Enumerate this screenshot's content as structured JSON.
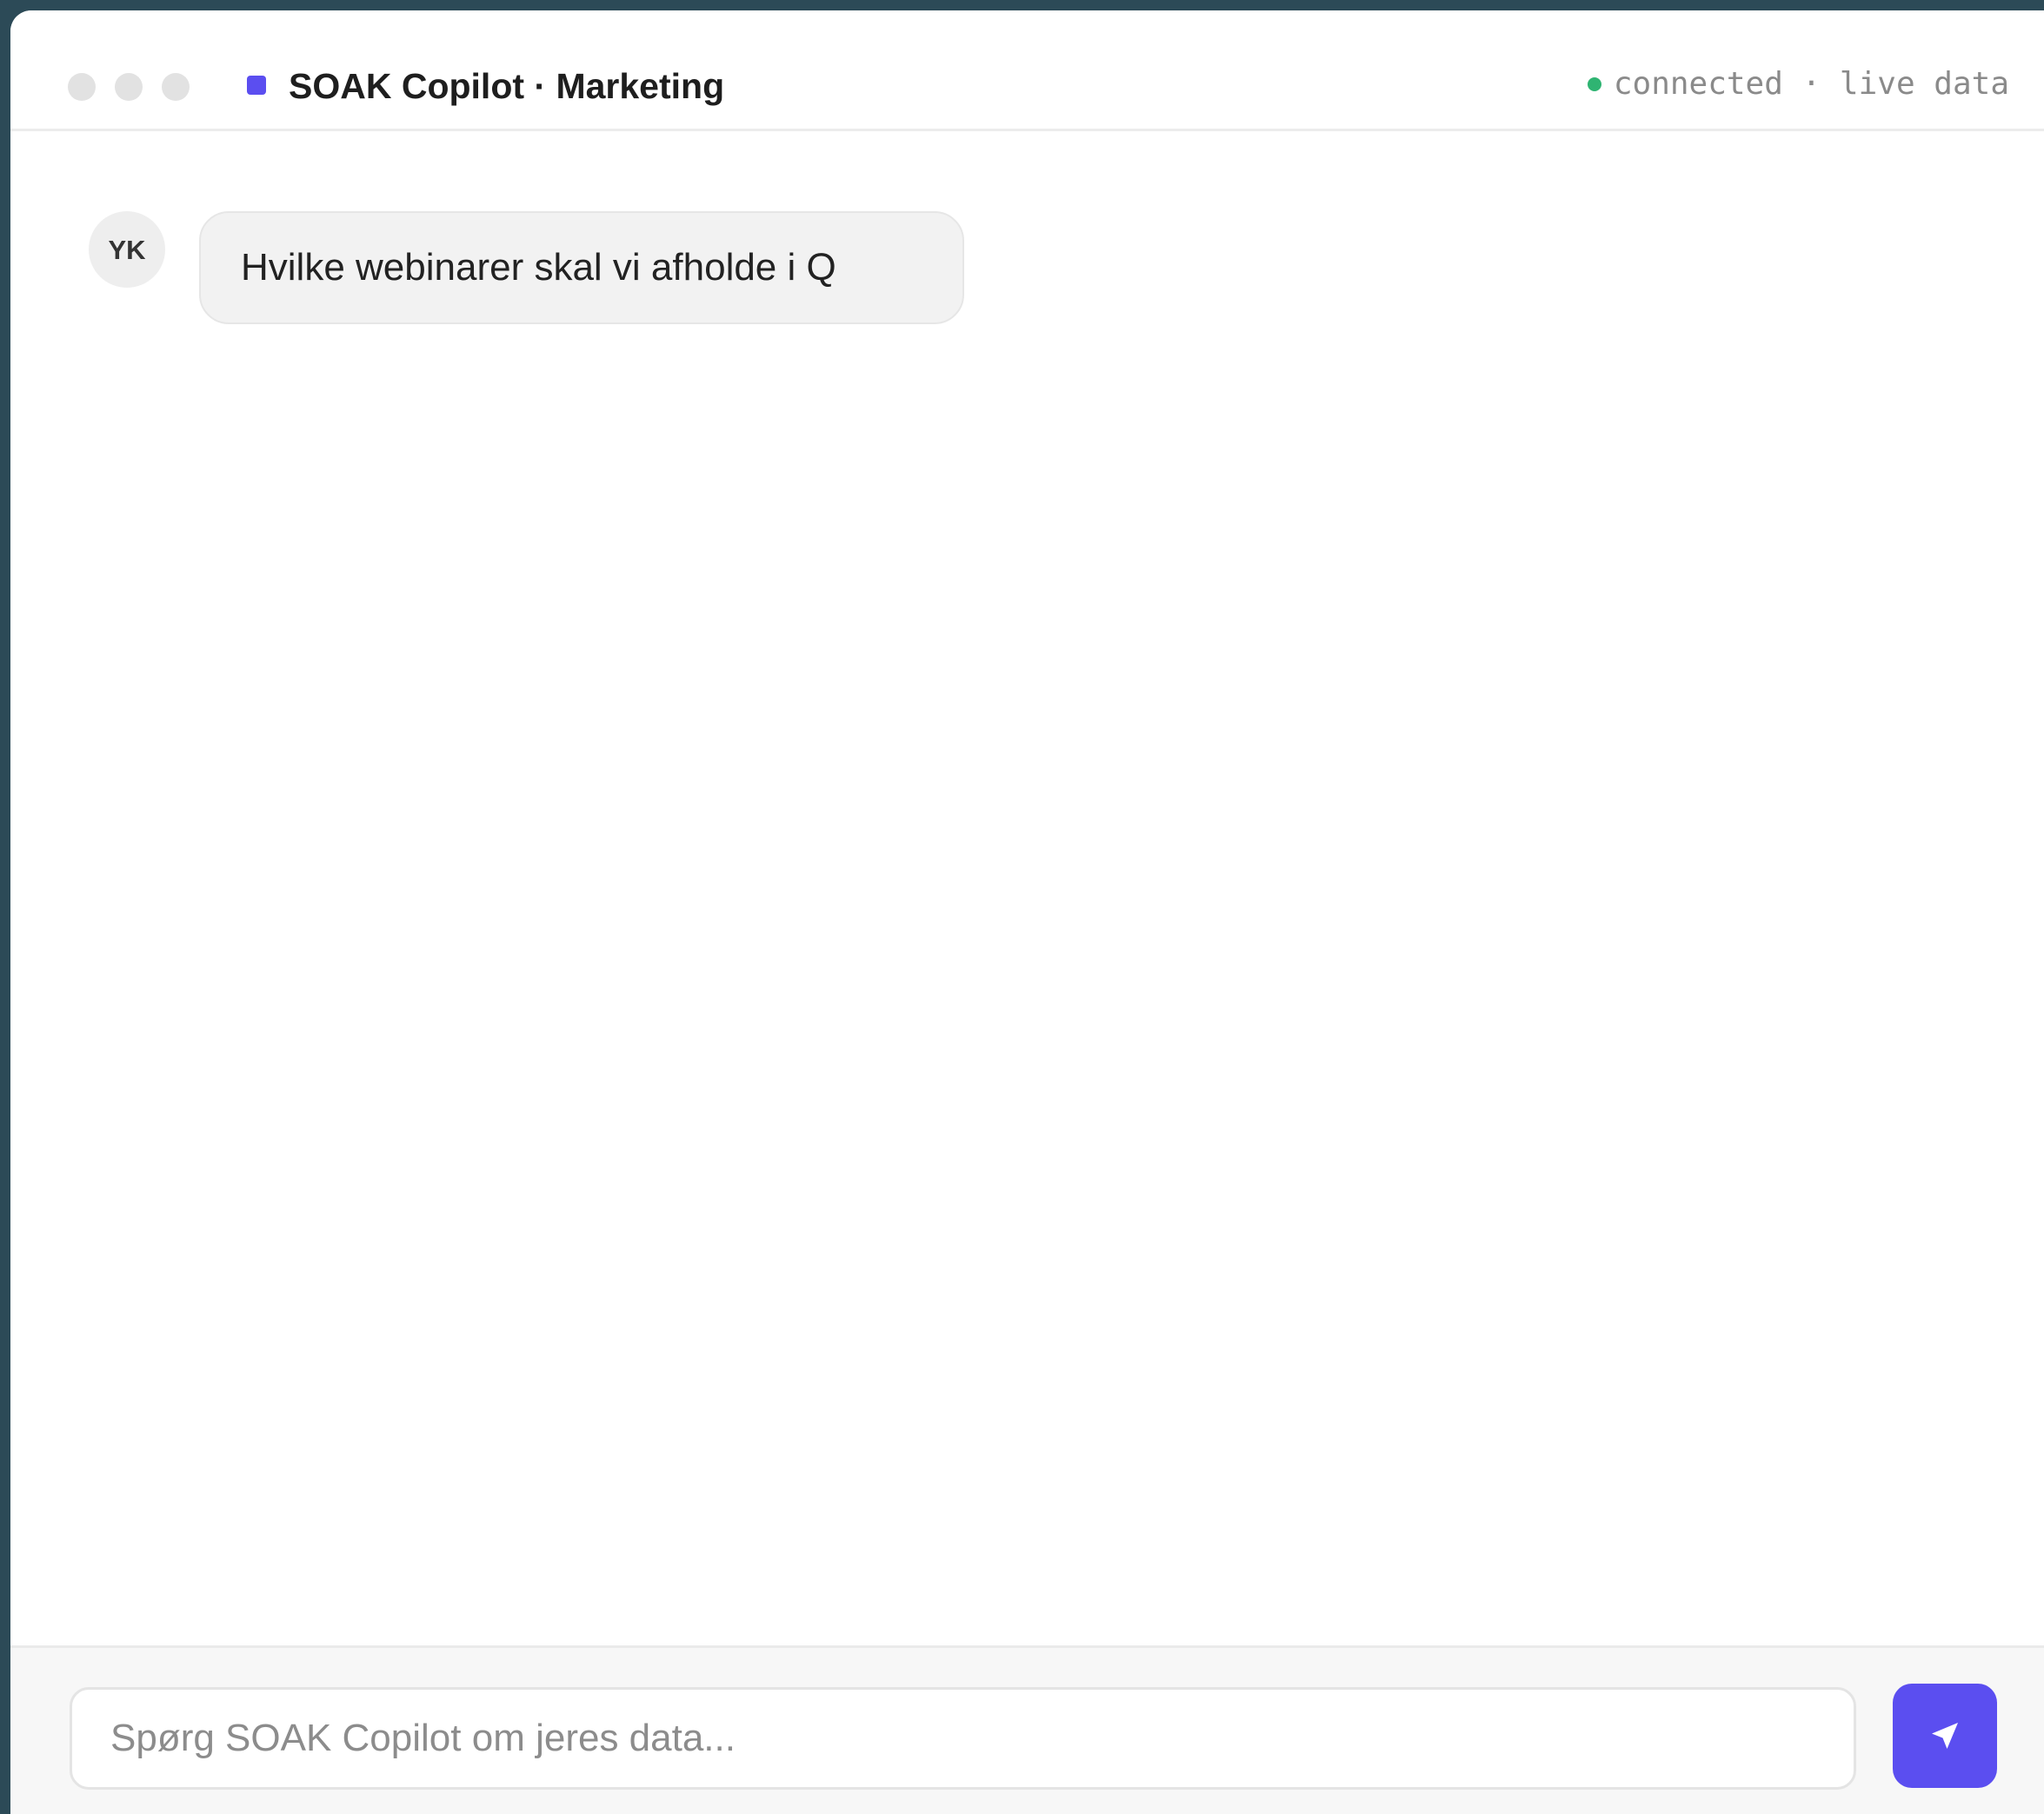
{
  "window": {
    "title": "SOAK Copilot · Marketing",
    "status_text": "connected · live data",
    "status_color": "#2fb472",
    "accent_color": "#5b4ef0"
  },
  "messages": [
    {
      "avatar_initials": "YK",
      "text": "Hvilke webinarer skal vi afholde i Q"
    }
  ],
  "composer": {
    "value": "",
    "placeholder": "Spørg SOAK Copilot om jeres data...",
    "send_icon": "send-icon"
  }
}
